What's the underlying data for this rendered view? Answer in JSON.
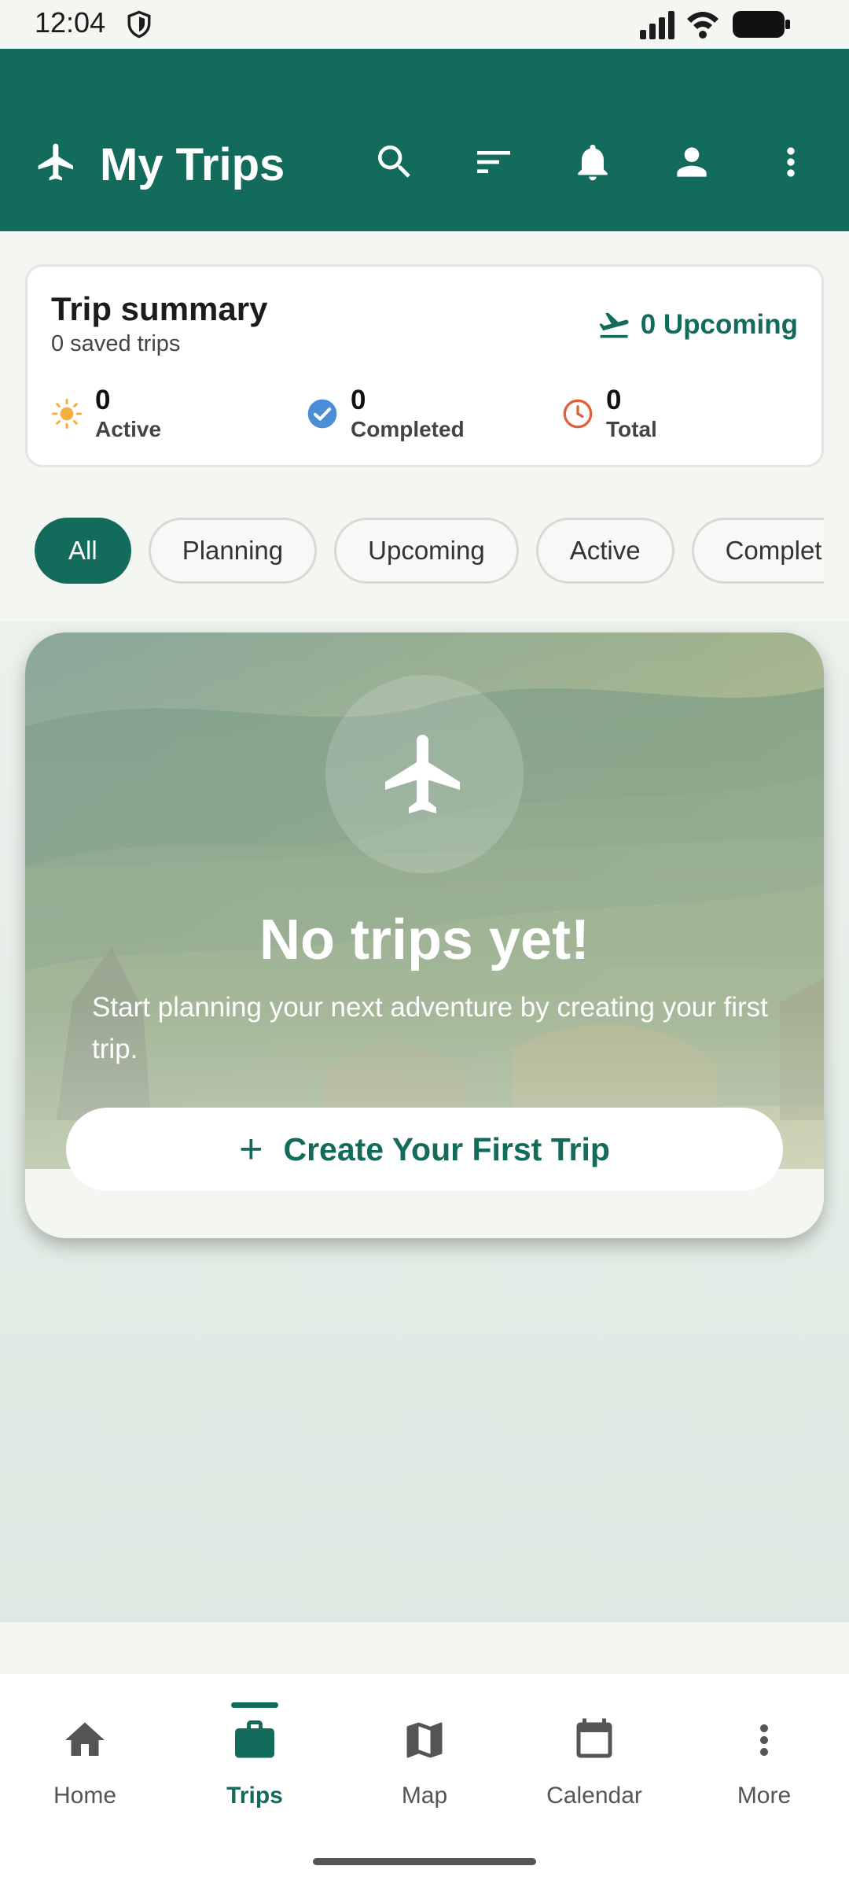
{
  "status_bar": {
    "time": "12:04"
  },
  "app_bar": {
    "title": "My Trips"
  },
  "summary": {
    "title": "Trip summary",
    "subtitle": "0 saved trips",
    "upcoming": "0 Upcoming",
    "stats": {
      "active": {
        "value": "0",
        "label": "Active"
      },
      "completed": {
        "value": "0",
        "label": "Completed"
      },
      "total": {
        "value": "0",
        "label": "Total"
      }
    }
  },
  "filters": {
    "selected": "All",
    "chips": [
      "All",
      "Planning",
      "Upcoming",
      "Active",
      "Complet"
    ]
  },
  "empty_state": {
    "title": "No trips yet!",
    "description": "Start planning your next adventure by creating your first trip.",
    "button_label": "Create Your First Trip"
  },
  "bottom_nav": {
    "items": [
      {
        "label": "Home",
        "icon": "home-icon"
      },
      {
        "label": "Trips",
        "icon": "briefcase-icon"
      },
      {
        "label": "Map",
        "icon": "map-icon"
      },
      {
        "label": "Calendar",
        "icon": "calendar-icon"
      },
      {
        "label": "More",
        "icon": "more-vertical-icon"
      }
    ],
    "active": "Trips"
  },
  "colors": {
    "primary": "#136b5b",
    "background": "#f3f6f1",
    "active_stat": "#f4b03e",
    "completed_stat": "#4a8fd6",
    "total_stat": "#e0603c"
  }
}
